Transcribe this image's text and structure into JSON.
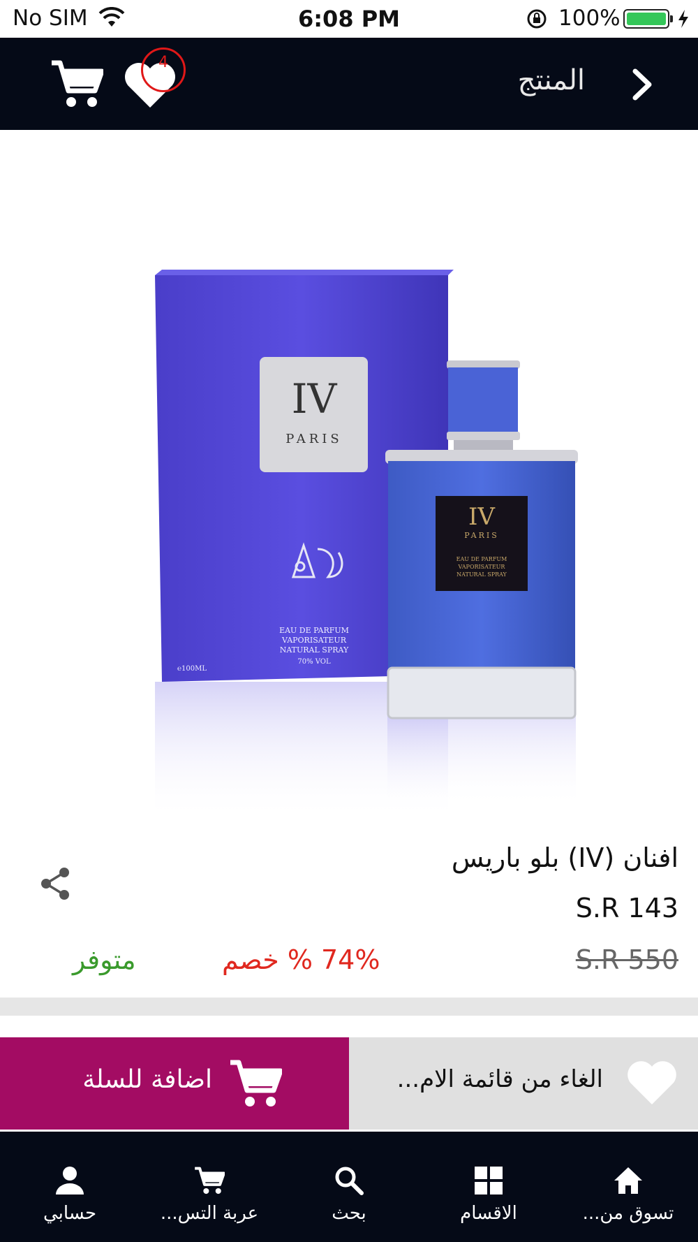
{
  "status_bar": {
    "carrier": "No SIM",
    "time": "6:08 PM",
    "battery": "100%"
  },
  "nav": {
    "title": "المنتج",
    "wishlist_count": "4"
  },
  "product_image": {
    "box_brand": "IV",
    "box_city": "PARIS",
    "box_line1": "EAU DE PARFUM",
    "box_line2": "VAPORISATEUR",
    "box_line3": "NATURAL SPRAY",
    "box_line4": "70% VOL",
    "box_volume": "℮100ML",
    "bottle_brand": "IV",
    "bottle_city": "PARIS",
    "bottle_line1": "EAU DE PARFUM",
    "bottle_line2": "VAPORISATEUR",
    "bottle_line3": "NATURAL SPRAY"
  },
  "product": {
    "name": "افنان (IV) بلو باريس",
    "price": "S.R 143",
    "old_price": "S.R 550",
    "discount": "74% % خصم",
    "stock": "متوفر"
  },
  "actions": {
    "add_to_cart": "اضافة للسلة",
    "remove_wishlist": "الغاء من قائمة الام..."
  },
  "tabs": [
    {
      "label": "تسوق من...",
      "icon": "home-icon"
    },
    {
      "label": "الاقسام",
      "icon": "grid-icon"
    },
    {
      "label": "بحث",
      "icon": "search-icon"
    },
    {
      "label": "عربة التس...",
      "icon": "cart-icon"
    },
    {
      "label": "حسابي",
      "icon": "person-icon"
    }
  ],
  "colors": {
    "nav_bg": "#050a17",
    "add_to_cart_bg": "#a30c63",
    "wishlist_bg": "#e0e0e0",
    "discount": "#e0281f",
    "in_stock": "#3a9a2c"
  }
}
